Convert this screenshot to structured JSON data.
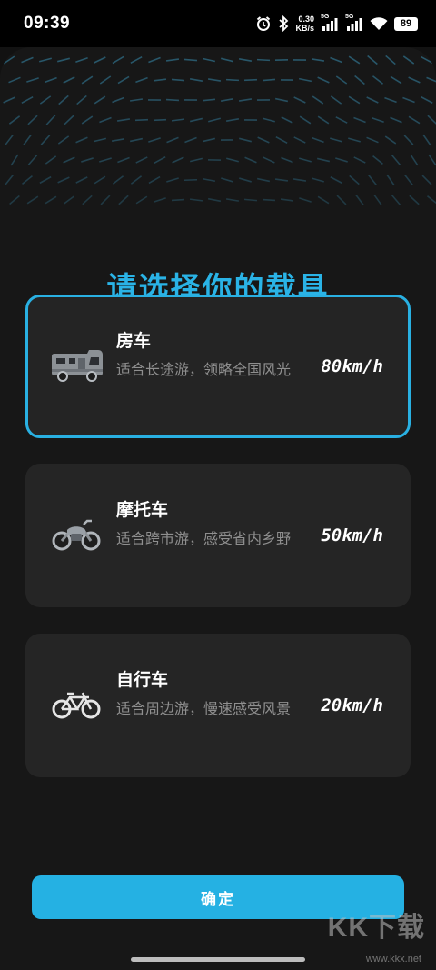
{
  "status_bar": {
    "time": "09:39",
    "net_speed_value": "0.30",
    "net_speed_unit": "KB/s",
    "signal1_label": "5G",
    "signal2_label": "5G",
    "battery": "89"
  },
  "page": {
    "title": "请选择你的载具",
    "confirm_label": "确定"
  },
  "vehicles": [
    {
      "icon": "rv-icon",
      "name": "房车",
      "desc": "适合长途游，领略全国风光",
      "speed": "80km/h",
      "selected": true
    },
    {
      "icon": "motorcycle-icon",
      "name": "摩托车",
      "desc": "适合跨市游，感受省内乡野",
      "speed": "50km/h",
      "selected": false
    },
    {
      "icon": "bicycle-icon",
      "name": "自行车",
      "desc": "适合周边游，慢速感受风景",
      "speed": "20km/h",
      "selected": false
    }
  ],
  "watermark": {
    "logo": "KK下载",
    "url": "www.kkx.net"
  },
  "colors": {
    "accent": "#29b0e2",
    "background": "#171717",
    "card": "#252525",
    "muted_text": "#8f8f8f"
  }
}
